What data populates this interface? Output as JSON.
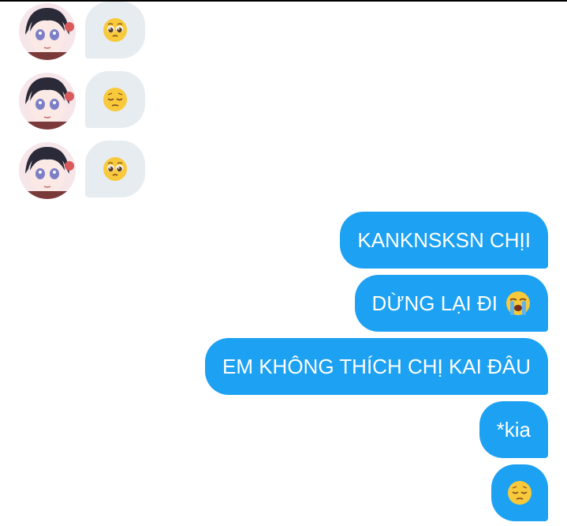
{
  "incoming": [
    {
      "emoji": "pleading-face-icon"
    },
    {
      "emoji": "pensive-face-icon"
    },
    {
      "emoji": "pleading-face-icon"
    }
  ],
  "outgoing": [
    {
      "text": "KANKNSKSN CHỊI"
    },
    {
      "text": "DỪNG LẠI ĐI",
      "emoji": "loudly-crying-face-icon"
    },
    {
      "text": "EM KHÔNG THÍCH CHỊ KAI ĐÂU"
    },
    {
      "text": "*kia"
    },
    {
      "emoji": "pensive-face-icon"
    }
  ],
  "colors": {
    "outgoing_bubble": "#1da1f2",
    "incoming_bubble": "#e6ecf0",
    "outgoing_text": "#ffffff"
  }
}
